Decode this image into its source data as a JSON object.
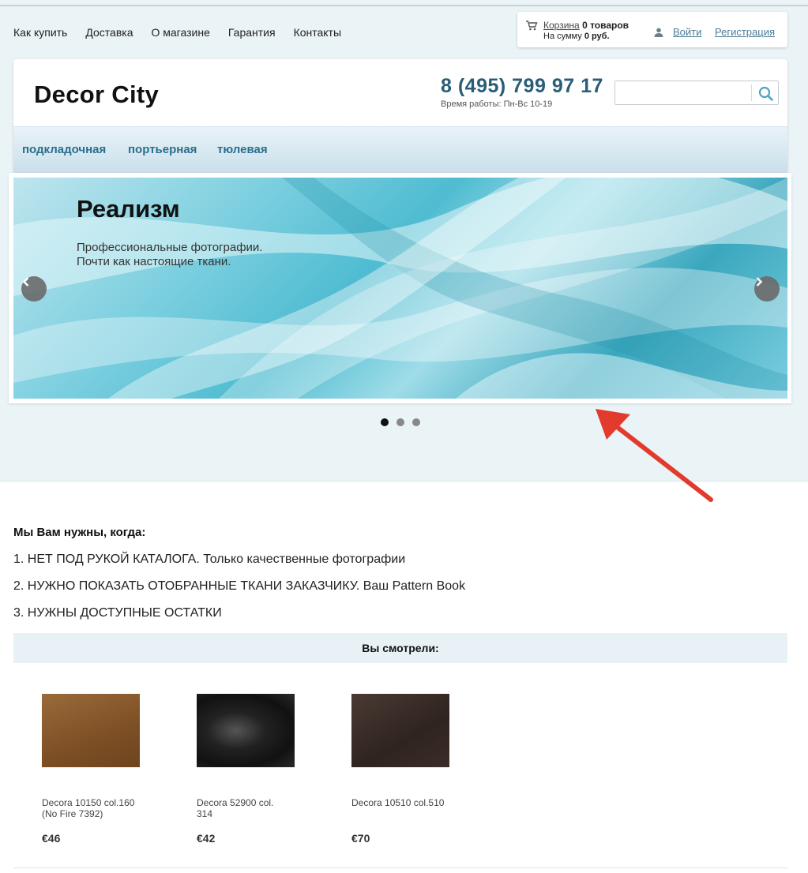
{
  "top_nav": [
    "Как купить",
    "Доставка",
    "О магазине",
    "Гарантия",
    "Контакты"
  ],
  "cart": {
    "link": "Корзина",
    "items": "0 товаров",
    "sum_prefix": "На сумму",
    "sum": "0 руб."
  },
  "account": {
    "login": "Войти",
    "register": "Регистрация"
  },
  "header": {
    "logo": "Decor City",
    "phone": "8 (495) 799 97 17",
    "hours": "Время работы: Пн-Вс 10-19",
    "search_placeholder": ""
  },
  "categories": [
    "подкладочная",
    "портьерная",
    "тюлевая"
  ],
  "slider": {
    "title": "Реализм",
    "line1": "Профессиональные фотографии.",
    "line2": "Почти как настоящие ткани.",
    "dots": 3,
    "active_dot": 1
  },
  "info": {
    "heading": "Мы Вам нужны, когда:",
    "items": [
      "1. НЕТ ПОД РУКОЙ КАТАЛОГА. Только качественные фотографии",
      "2. НУЖНО ПОКАЗАТЬ ОТОБРАННЫЕ ТКАНИ ЗАКАЗЧИКУ. Ваш Pattern Book",
      "3. НУЖНЫ ДОСТУПНЫЕ ОСТАТКИ"
    ]
  },
  "viewed": {
    "title": "Вы смотрели:",
    "products": [
      {
        "name": "Decora 10150 col.160 (No Fire 7392)",
        "price": "€46",
        "color": "#8b5a2b"
      },
      {
        "name": "Decora 52900 col. 314",
        "price": "€42",
        "color": "#1e1e1e"
      },
      {
        "name": "Decora 10510 col.510",
        "price": "€70",
        "color": "#3a2d28"
      }
    ]
  },
  "colors": {
    "accent": "#2a6e8d",
    "phone": "#2a5d77",
    "band": "#eaf3f6",
    "arrow": "#e23b2e"
  }
}
